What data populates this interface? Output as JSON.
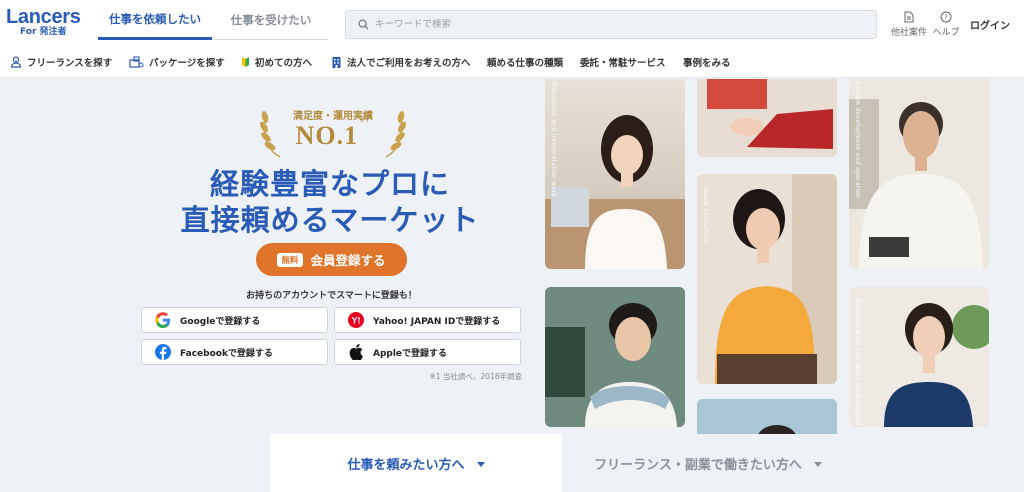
{
  "brand": {
    "name": "Lancers",
    "sub": "For 発注者"
  },
  "header": {
    "tabs": [
      "仕事を依頼したい",
      "仕事を受けたい"
    ],
    "search_placeholder": "キーワードで検索",
    "other_cases": "他社案件",
    "help": "ヘルプ",
    "login": "ログイン"
  },
  "nav": [
    "フリーランスを探す",
    "パッケージを探す",
    "初めての方へ",
    "法人でご利用をお考えの方へ",
    "頼める仕事の種類",
    "委託・常駐サービス",
    "事例をみる"
  ],
  "hero": {
    "award_top": "満足度・運用実績",
    "award_main": "NO.1",
    "award_sup": "※1",
    "headline_1": "経験豊富なプロに",
    "headline_2": "直接頼めるマーケット",
    "cta_badge": "無料",
    "cta_label": "会員登録する",
    "social_lead": "お持ちのアカウントでスマートに登録も！",
    "social": {
      "google": "Googleで登録する",
      "yahoo": "Yahoo! JAPAN IDで登録する",
      "facebook": "Facebookで登録する",
      "apple": "Appleで登録する"
    },
    "footnote": "※1 当社調べ。2018年調査"
  },
  "photos": {
    "p1": "Translation and interpretation work",
    "p4": "Image production",
    "p6": "System development and operation",
    "p7": "Business work and office work support"
  },
  "bottom_tabs": [
    "仕事を頼みたい方へ",
    "フリーランス・副業で働きたい方へ"
  ],
  "colors": {
    "brand_blue": "#2a5bb6",
    "cta_orange": "#e0742a",
    "gold": "#b28a3a"
  }
}
